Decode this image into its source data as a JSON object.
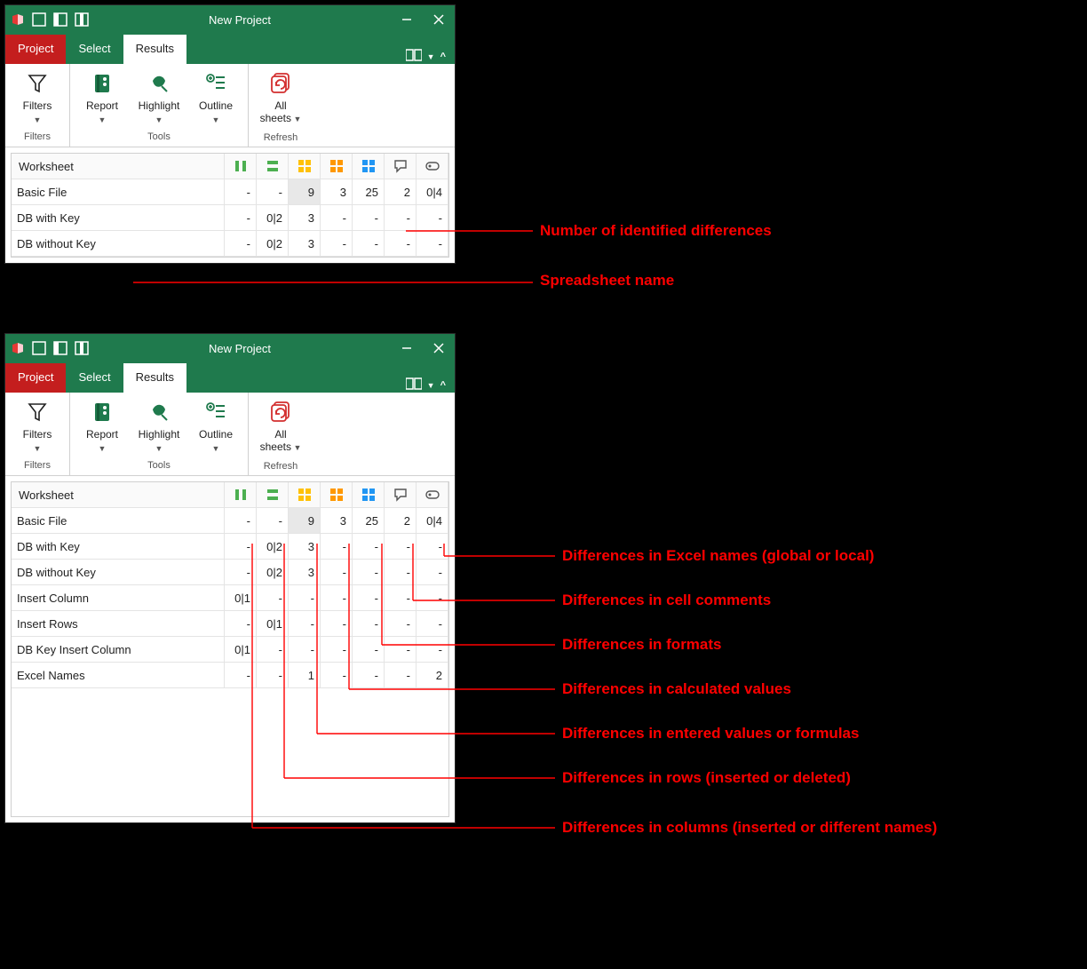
{
  "title": "New Project",
  "tabs": {
    "project": "Project",
    "select": "Select",
    "results": "Results"
  },
  "ribbon": {
    "filters": {
      "label": "Filters",
      "group": "Filters"
    },
    "report": {
      "label": "Report"
    },
    "highlight": {
      "label": "Highlight"
    },
    "outline": {
      "label": "Outline"
    },
    "tools_group": "Tools",
    "allsheets": {
      "label": "All\nsheets",
      "line1": "All",
      "line2": "sheets"
    },
    "refresh_group": "Refresh"
  },
  "grid_header": {
    "worksheet": "Worksheet"
  },
  "columns_meaning": {
    "c0": "columns (inserted or different names)",
    "c1": "rows (inserted or deleted)",
    "c2": "entered values or formulas",
    "c3": "calculated values",
    "c4": "formats",
    "c5": "cell comments",
    "c6": "Excel names (global or local)"
  },
  "rows_top": [
    {
      "name": "Basic File",
      "cells": [
        "-",
        "-",
        "9",
        "3",
        "25",
        "2",
        "0|4"
      ],
      "hi": 2
    },
    {
      "name": "DB with Key",
      "cells": [
        "-",
        "0|2",
        "3",
        "-",
        "-",
        "-",
        "-"
      ],
      "hi": -1
    },
    {
      "name": "DB without Key",
      "cells": [
        "-",
        "0|2",
        "3",
        "-",
        "-",
        "-",
        "-"
      ],
      "hi": -1
    }
  ],
  "rows_bottom": [
    {
      "name": "Basic File",
      "cells": [
        "-",
        "-",
        "9",
        "3",
        "25",
        "2",
        "0|4"
      ],
      "hi": 2
    },
    {
      "name": "DB with Key",
      "cells": [
        "-",
        "0|2",
        "3",
        "-",
        "-",
        "-",
        "-"
      ],
      "hi": -1
    },
    {
      "name": "DB without Key",
      "cells": [
        "-",
        "0|2",
        "3",
        "-",
        "-",
        "-",
        "-"
      ],
      "hi": -1
    },
    {
      "name": "Insert Column",
      "cells": [
        "0|1",
        "-",
        "-",
        "-",
        "-",
        "-",
        "-"
      ],
      "hi": -1
    },
    {
      "name": "Insert Rows",
      "cells": [
        "-",
        "0|1",
        "-",
        "-",
        "-",
        "-",
        "-"
      ],
      "hi": -1
    },
    {
      "name": "DB Key Insert Column",
      "cells": [
        "0|1",
        "-",
        "-",
        "-",
        "-",
        "-",
        "-"
      ],
      "hi": -1
    },
    {
      "name": "Excel Names",
      "cells": [
        "-",
        "-",
        "1",
        "-",
        "-",
        "-",
        "2"
      ],
      "hi": -1
    }
  ],
  "annotations": {
    "num_diff": "Number of identified differences",
    "ss_name": "Spreadsheet name",
    "names": "Differences in Excel names (global or local)",
    "comments": "Differences in cell comments",
    "formats": "Differences in formats",
    "calc": "Differences in calculated values",
    "entered": "Differences in entered values or formulas",
    "rows": "Differences in rows (inserted or deleted)",
    "cols": "Differences in columns (inserted or different names)"
  }
}
